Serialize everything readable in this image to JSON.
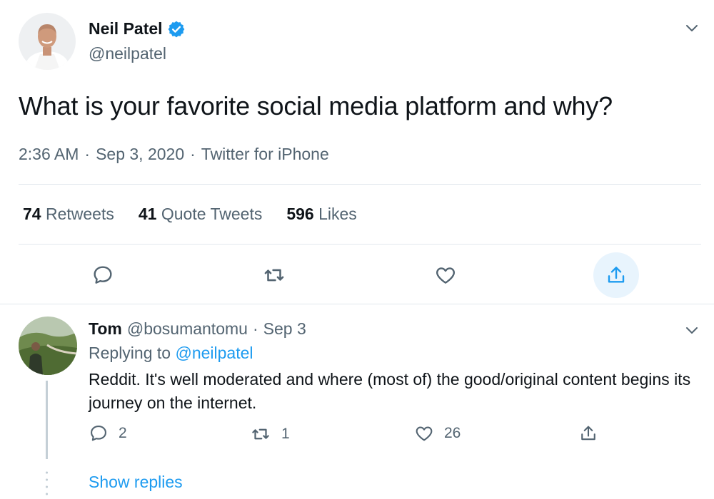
{
  "main_tweet": {
    "author_name": "Neil Patel",
    "author_handle": "@neilpatel",
    "text": "What is your favorite social media platform and why?",
    "time": "2:36 AM",
    "date": "Sep 3, 2020",
    "source": "Twitter for iPhone",
    "separator": "·",
    "stats": {
      "retweets_count": "74",
      "retweets_label": "Retweets",
      "quotes_count": "41",
      "quotes_label": "Quote Tweets",
      "likes_count": "596",
      "likes_label": "Likes"
    }
  },
  "reply": {
    "author_name": "Tom",
    "author_handle": "@bosumantomu",
    "separator": "·",
    "date": "Sep 3",
    "replying_prefix": "Replying to",
    "replying_mention": "@neilpatel",
    "text": "Reddit. It's well moderated and where (most of) the good/original content begins its journey on the internet.",
    "reply_count": "2",
    "retweet_count": "1",
    "like_count": "26",
    "show_replies_label": "Show replies"
  },
  "icons": {
    "verified": "verified-badge-icon",
    "chevron": "chevron-down-icon",
    "reply": "speech-bubble-icon",
    "retweet": "retweet-arrows-icon",
    "like": "heart-icon",
    "share": "share-upload-icon"
  },
  "colors": {
    "accent": "#1d9bf0",
    "text_primary": "#0f1419",
    "text_secondary": "#536471",
    "divider": "#e1e8ed",
    "share_highlight": "#e8f4fd"
  }
}
